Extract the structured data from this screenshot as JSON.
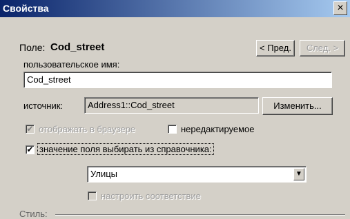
{
  "window": {
    "title": "Свойства",
    "close_glyph": "×"
  },
  "header": {
    "field_prefix": "Поле:",
    "field_name": "Cod_street"
  },
  "nav": {
    "prev_label": "< Пред.",
    "next_label": "След. >"
  },
  "custom_name": {
    "label": "пользовательское имя:",
    "value": "Cod_street"
  },
  "source": {
    "label": "источник:",
    "value": "Address1::Cod_street",
    "change_label": "Изменить..."
  },
  "options": {
    "show_in_browser_label": "отображать в браузере",
    "show_in_browser_checked": true,
    "readonly_label": "нередактируемое",
    "readonly_checked": false,
    "pick_from_dict_label": "значение поля выбирать из справочника:",
    "pick_from_dict_checked": true
  },
  "dictionary": {
    "selected": "Улицы"
  },
  "mapping": {
    "label": "настроить соответствие"
  },
  "style": {
    "label": "Стиль:"
  },
  "icons": {
    "close": "close-icon",
    "dropdown": "chevron-down-icon"
  }
}
